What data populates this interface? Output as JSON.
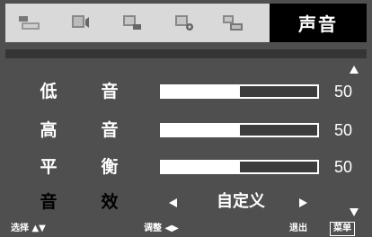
{
  "menu": {
    "title": "声音",
    "icons": [
      "picture-menu-icon",
      "sound-menu-icon",
      "display-menu-icon",
      "setup-menu-icon",
      "source-menu-icon"
    ]
  },
  "items": [
    {
      "label_a": "低",
      "label_b": "音",
      "value": "50",
      "level": 0.5
    },
    {
      "label_a": "高",
      "label_b": "音",
      "value": "50",
      "level": 0.5
    },
    {
      "label_a": "平",
      "label_b": "衡",
      "value": "50",
      "level": 0.5
    }
  ],
  "effect": {
    "label_a": "音",
    "label_b": "效",
    "value": "自定义"
  },
  "footer": {
    "hint1": "选择 ▲▼",
    "hint2": "调整 ◀▶",
    "hint3": "退出",
    "hint4": "菜单"
  },
  "colors": {
    "background": "#4f4f4f",
    "icon_bar": "#d9d9d9",
    "title_bg": "#000000",
    "fill": "#ffffff"
  }
}
